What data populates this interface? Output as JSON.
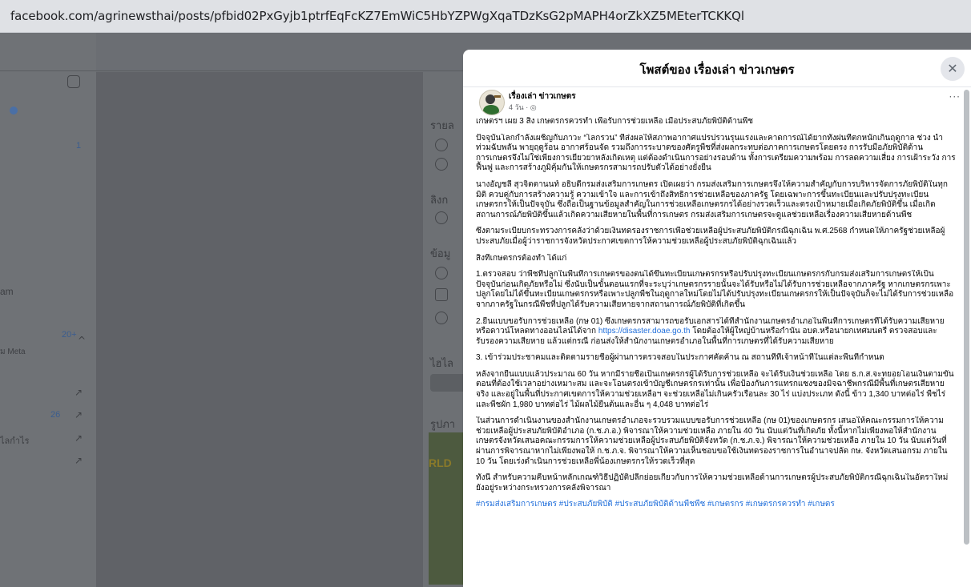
{
  "browser": {
    "url": "facebook.com/agrinewsthai/posts/pfbid02PxGyjb1ptrfEqFcKZ7EmWiC5HbYZPWgXqaTDzKsG2pMAPH4orZkXZ5MEterTCKKQl"
  },
  "background": {
    "left_labels": [
      "am",
      "ม Meta",
      "ไลกำไร"
    ],
    "counts": [
      "1",
      "20+",
      "26"
    ],
    "mid_labels": [
      "รายล",
      "ลิงก",
      "ข้อมู",
      "ไฮไล",
      "รูปภา"
    ]
  },
  "modal": {
    "title": "โพสต์ของ เรื่องเล่า ข่าวเกษตร",
    "close_label": "✕",
    "author": "เรื่องเล่า ข่าวเกษตร",
    "post_meta": "4 วัน · ◎",
    "more_label": "···",
    "paragraphs": [
      "เกษตรฯ เผย 3 สิ่ง เกษตรกรควรทำ เพื่อรับการช่วยเหลือ เมื่อประสบภัยพิบัติด้านพืช",
      "ปัจจุบันโลกกำลังเผชิญกับภาวะ “โลกรวน” ที่ส่งผลให้สภาพอากาศแปรปรวนรุนแรงและคาดการณ์ได้ยากทั้งฝนที่ตกหนักเกินฤดูกาล ช่วง น้ำท่วมฉับพลัน พายุฤดูร้อน อากาศร้อนจัด รวมถึงการระบาดของศัตรูพืชที่ส่งผลกระทบต่อภาคการเกษตรโดยตรง การรับมือภัยพิบัติด้านการเกษตรจึงไม่ใช่เพียงการเยียวยาหลังเกิดเหตุ แต่ต้องดำเนินการอย่างรอบด้าน ทั้งการเตรียมความพร้อม การลดความเสี่ยง การเฝ้าระวัง การฟื้นฟู และการสร้างภูมิคุ้มกันให้เกษตรกรสามารถปรับตัวได้อย่างยั่งยืน",
      "นางอัญชลี สุวจิตตานนท์ อธิบดีกรมส่งเสริมการเกษตร เปิดเผยว่า กรมส่งเสริมการเกษตรจึงให้ความสำคัญกับการบริหารจัดการภัยพิบัติในทุกมิติ ควบคู่กับการสร้างความรู้ ความเข้าใจ และการเข้าถึงสิทธิการช่วยเหลือของภาครัฐ โดยเฉพาะการขึ้นทะเบียนและปรับปรุงทะเบียนเกษตรกรให้เป็นปัจจุบัน ซึ่งถือเป็นฐานข้อมูลสำคัญในการช่วยเหลือเกษตรกรได้อย่างรวดเร็วและตรงเป้าหมายเมื่อเกิดภัยพิบัติขึ้น เมื่อเกิดสถานการณ์ภัยพิบัติขึ้นแล้วเกิดความเสียหายในพื้นที่การเกษตร กรมส่งเสริมการเกษตรจะดูแลช่วยเหลือเรื่องความเสียหายด้านพืช",
      "ซึ่งตามระเบียบกระทรวงการคลังว่าด้วยเงินทดรองราชการเพื่อช่วยเหลือผู้ประสบภัยพิบัติกรณีฉุกเฉิน พ.ศ.2568 กำหนดให้ภาครัฐช่วยเหลือผู้ประสบภัยเมื่อผู้ว่าราชการจังหวัดประกาศเขตการให้ความช่วยเหลือผู้ประสบภัยพิบัติฉุกเฉินแล้ว",
      "สิ่งที่เกษตรกรต้องทำ ได้แก่",
      "1.ตรวจสอบ ว่าพืชที่ปลูกในพื้นที่การเกษตรของตนได้ขึ้นทะเบียนเกษตรกรหรือปรับปรุงทะเบียนเกษตรกรกับกรมส่งเสริมการเกษตรให้เป็นปัจจุบันก่อนเกิดภัยหรือไม่ ซึ่งนับเป็นขั้นตอนแรกที่จะระบุว่าเกษตรกรรายนั้นจะได้รับหรือไม่ได้รับการช่วยเหลือจากภาครัฐ หากเกษตรกรเพาะปลูกโดยไม่ได้ขึ้นทะเบียนเกษตรกรหรือเพาะปลูกพืชในฤดูกาลใหม่โดยไม่ได้ปรับปรุงทะเบียนเกษตรกรให้เป็นปัจจุบันก็จะไม่ได้รับการช่วยเหลือจากภาครัฐในกรณีพืชที่ปลูกได้รับความเสียหายจากสถานการณ์ภัยพิบัติที่เกิดขึ้น",
      "2.ยื่นแบบขอรับการช่วยเหลือ (กษ 01) ซึ่งเกษตรกรสามารถขอรับเอกสารได้ที่สำนักงานเกษตรอำเภอในพื้นที่การเกษตรที่ได้รับความเสียหาย หรือดาวน์โหลดทางออนไลน์ได้จาก",
      "https://disaster.doae.go.th",
      "โดยต้องให้ผู้ใหญ่บ้านหรือกำนัน อบต.หรือนายกเทศมนตรี ตรวจสอบและรับรองความเสียหาย แล้วแต่กรณี ก่อนส่งให้สำนักงานเกษตรอำเภอในพื้นที่การเกษตรที่ได้รับความเสียหาย",
      "3. เข้าร่วมประชาคมและติดตามรายชื่อผู้ผ่านการตรวจสอบในประกาศคัดค้าน ณ สถานที่ที่เจ้าหน้าที่ในแต่ละพื้นที่กำหนด",
      "หลังจากยื่นแบบแล้วประมาณ 60 วัน หากมีรายชื่อเป็นเกษตรกรผู้ได้รับการช่วยเหลือ จะได้รับเงินช่วยเหลือ โดย ธ.ก.ส.จะทยอยโอนเงินตามขั้นตอนที่ต้องใช้เวลาอย่างเหมาะสม และจะโอนตรงเข้าบัญชีเกษตรกรเท่านั้น เพื่อป้องกันการแทรกแซงของมิจฉาชีพกรณีมีพื้นที่เกษตรเสียหายจริง และอยู่ในพื้นที่ประกาศเขตการให้ความช่วยเหลือฯ จะช่วยเหลือไม่เกินครัวเรือนละ 30 ไร่ แบ่งประเภท ดังนี้ ข้าว 1,340 บาทต่อไร่ พืชไร่และพืชผัก 1,980 บาทต่อไร่ ไม้ผลไม้ยืนต้นและอื่น ๆ 4,048 บาทต่อไร่",
      "ในส่วนการดำเนินงานของสำนักงานเกษตรอำเภอจะรวบรวมแบบขอรับการช่วยเหลือ (กษ 01)ของเกษตรกร เสนอให้คณะกรรมการให้ความช่วยเหลือผู้ประสบภัยพิบัติอำเภอ (ก.ช.ภ.อ.) พิจารณาให้ความช่วยเหลือ ภายใน 40 วัน นับแต่วันที่เกิดภัย ทั้งนี้หากไม่เพียงพอให้สำนักงานเกษตรจังหวัดเสนอคณะกรรมการให้ความช่วยเหลือผู้ประสบภัยพิบัติจังหวัด (ก.ช.ภ.จ.) พิจารณาให้ความช่วยเหลือ ภายใน 10 วัน นับแต่วันที่ผ่านการพิจารณาหากไม่เพียงพอให้ ก.ช.ภ.จ. พิจารณาให้ความเห็นชอบขอใช้เงินทดรองราชการในอำนาจปลัด กษ. จังหวัดเสนอกรม ภายใน 10 วัน โดยเร่งดำเนินการช่วยเหลือพี่น้องเกษตรกรให้รวดเร็วที่สุด",
      "ทั้งนี้ สำหรับความคืบหน้าหลักเกณฑ์วิธีปฏิบัติปลีกย่อยเกี่ยวกับการให้ความช่วยเหลือด้านการเกษตรผู้ประสบภัยพิบัติกรณีฉุกเฉินในอัตราใหม่ยังอยู่ระหว่างกระทรวงการคลังพิจารณา"
    ],
    "hashtags": "#กรมส่งเสริมการเกษตร #ประสบภัยพิบัติ #ประสบภัยพิบัติด้านพืชพืช #เกษตรกร #เกษตรกรควรทำ #เกษตร"
  }
}
